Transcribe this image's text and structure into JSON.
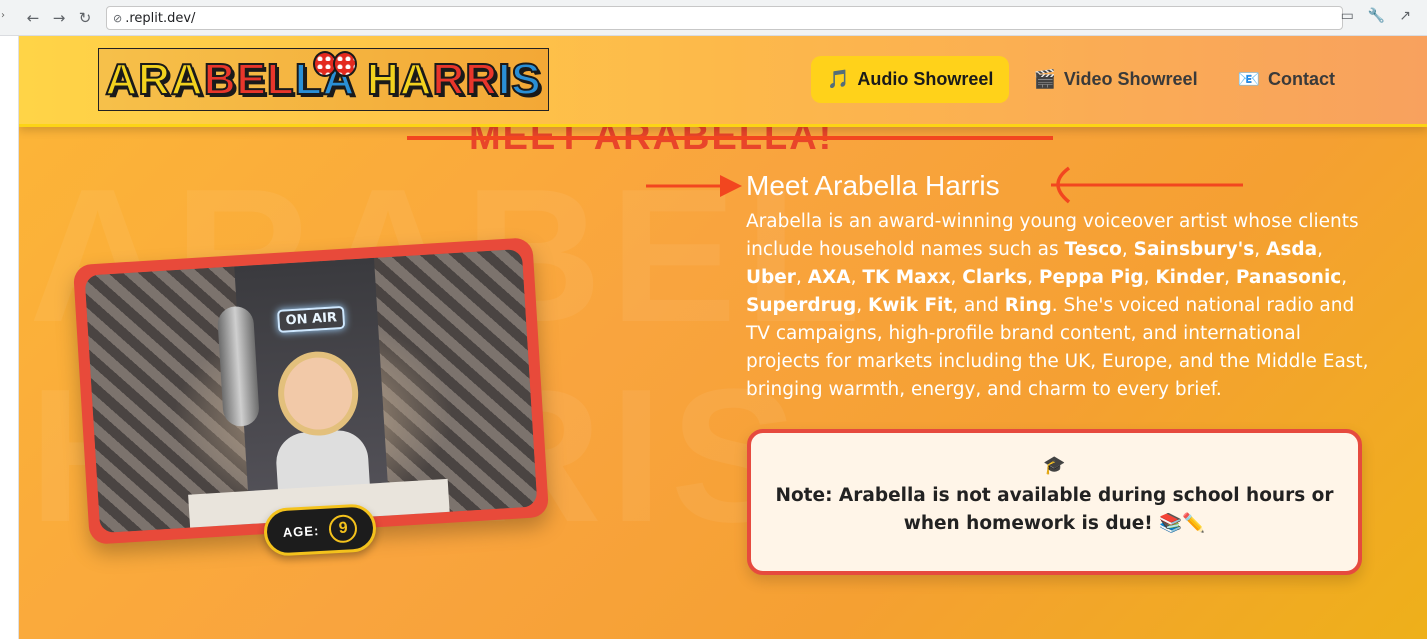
{
  "browser": {
    "url": ".replit.dev/",
    "back_icon": "arrow-left-icon",
    "forward_icon": "arrow-right-icon",
    "reload_icon": "reload-icon"
  },
  "header": {
    "logo_letters": [
      "ARA",
      "BEL",
      "LA",
      " HA",
      "RR",
      "IS",
      ""
    ],
    "logo_alt": "ARABELLA HARRIS",
    "nav": [
      {
        "icon": "🎵",
        "label": "Audio Showreel",
        "active": true
      },
      {
        "icon": "🎬",
        "label": "Video Showreel",
        "active": false
      },
      {
        "icon": "📧",
        "label": "Contact",
        "active": false
      }
    ]
  },
  "hero": {
    "struck_title": "MEET ARABELLA!",
    "title": "Meet Arabella Harris",
    "background_word_1": "ARABEL",
    "background_word_2": "HARRIS",
    "bio_intro": "Arabella is an award-winning young voiceover artist whose clients include household names such as ",
    "clients": [
      "Tesco",
      "Sainsbury's",
      "Asda",
      "Uber",
      "AXA",
      "TK Maxx",
      "Clarks",
      "Peppa Pig",
      "Kinder",
      "Panasonic",
      "Superdrug",
      "Kwik Fit",
      "Ring"
    ],
    "bio_rest": ". She's voiced national radio and TV campaigns, high-profile brand content, and international projects for markets including the UK, Europe, and the Middle East, bringing warmth, energy, and charm to every brief."
  },
  "photo": {
    "sign": "ON AIR",
    "age_label": "AGE:",
    "age_value": "9"
  },
  "note": {
    "icon": "graduation-cap-icon",
    "text": "Note: Arabella is not available during school hours or when homework is due! 📚✏️"
  },
  "colors": {
    "accent_yellow": "#ffd21a",
    "annotation_red": "#f2461f",
    "note_border": "#e64a3e"
  }
}
